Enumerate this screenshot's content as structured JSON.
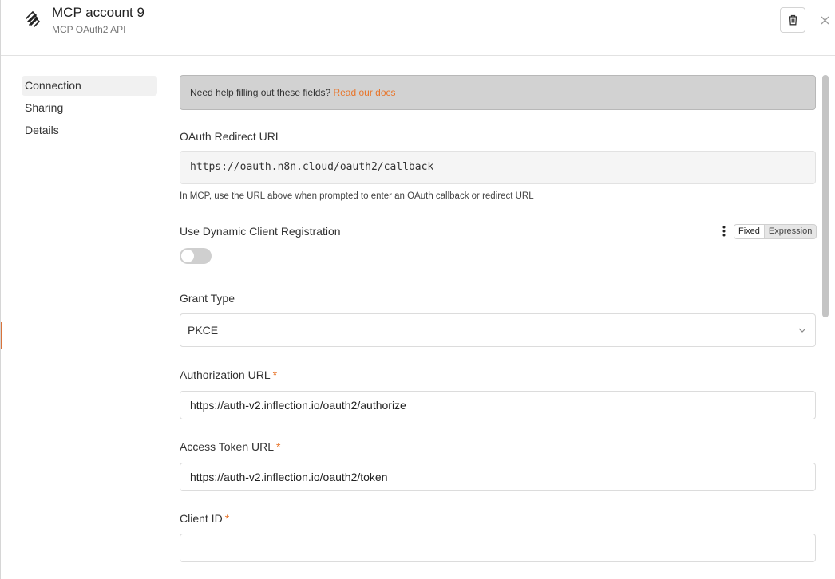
{
  "header": {
    "title": "MCP account 9",
    "subtitle": "MCP OAuth2 API"
  },
  "sidebar": {
    "items": [
      {
        "label": "Connection",
        "active": true
      },
      {
        "label": "Sharing",
        "active": false
      },
      {
        "label": "Details",
        "active": false
      }
    ]
  },
  "help": {
    "text": "Need help filling out these fields? ",
    "link": "Read our docs"
  },
  "redirect": {
    "label": "OAuth Redirect URL",
    "value": "https://oauth.n8n.cloud/oauth2/callback",
    "hint": "In MCP, use the URL above when prompted to enter an OAuth callback or redirect URL"
  },
  "dynamic_registration": {
    "label": "Use Dynamic Client Registration",
    "enabled": false,
    "mode_fixed": "Fixed",
    "mode_expression": "Expression"
  },
  "grant_type": {
    "label": "Grant Type",
    "value": "PKCE"
  },
  "authorization_url": {
    "label": "Authorization URL",
    "required": "*",
    "value": "https://auth-v2.inflection.io/oauth2/authorize"
  },
  "access_token_url": {
    "label": "Access Token URL",
    "required": "*",
    "value": "https://auth-v2.inflection.io/oauth2/token"
  },
  "client_id": {
    "label": "Client ID",
    "required": "*",
    "value": ""
  },
  "colors": {
    "accent": "#e8762c",
    "help_bg": "#d2d2d2",
    "toggle_off": "#cfcfcf"
  },
  "icons": {
    "logo": "mcp-logo-icon",
    "delete": "trash-icon",
    "close": "close-icon",
    "menu": "kebab-icon",
    "dropdown": "chevron-down-icon"
  }
}
